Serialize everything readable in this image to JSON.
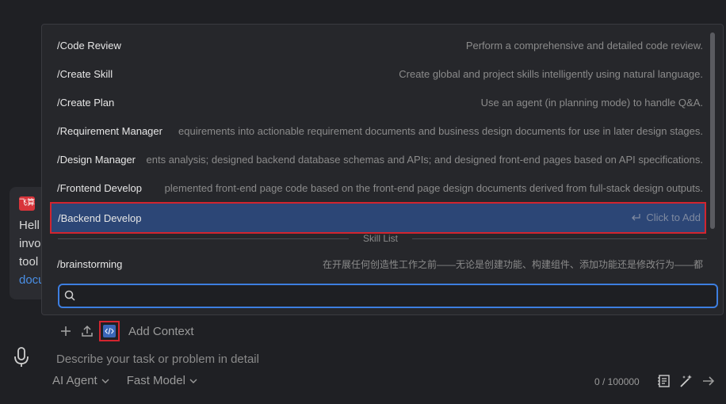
{
  "chat": {
    "logo_text": "飞算",
    "lines": [
      "Hell",
      "invo",
      "tool",
      "docu"
    ]
  },
  "commands": [
    {
      "name": "/Code Review",
      "description": "Perform a comprehensive and detailed code review."
    },
    {
      "name": "/Create Skill",
      "description": "Create global and project skills intelligently using natural language."
    },
    {
      "name": "/Create Plan",
      "description": "Use an agent (in planning mode) to handle Q&A."
    },
    {
      "name": "/Requirement Manager",
      "description": "equirements into actionable requirement documents and business design documents for use in later design stages."
    },
    {
      "name": "/Design Manager",
      "description": "ents analysis; designed backend database schemas and APIs; and designed front-end pages based on API specifications."
    },
    {
      "name": "/Frontend Develop",
      "description": "plemented front-end page code based on the front-end page design documents derived from full-stack design outputs."
    },
    {
      "name": "/Backend Develop",
      "description": "Click to Add",
      "selected": true
    }
  ],
  "divider_label": "Skill List",
  "skills": [
    {
      "name": "/brainstorming",
      "description": "在开展任何创造性工作之前——无论是创建功能、构建组件、添加功能还是修改行为——都"
    }
  ],
  "popup_search": {
    "value": "",
    "placeholder": ""
  },
  "toolbar": {
    "add_context_label": "Add Context"
  },
  "input": {
    "placeholder": "Describe your task or problem in detail"
  },
  "bottom": {
    "agent_label": "AI Agent",
    "model_label": "Fast Model",
    "char_count": "0 / 100000"
  },
  "colors": {
    "selected_row": "#2c4676",
    "highlight_border": "#d2252f",
    "search_border": "#3d7ee0",
    "link": "#4a8fe6"
  }
}
